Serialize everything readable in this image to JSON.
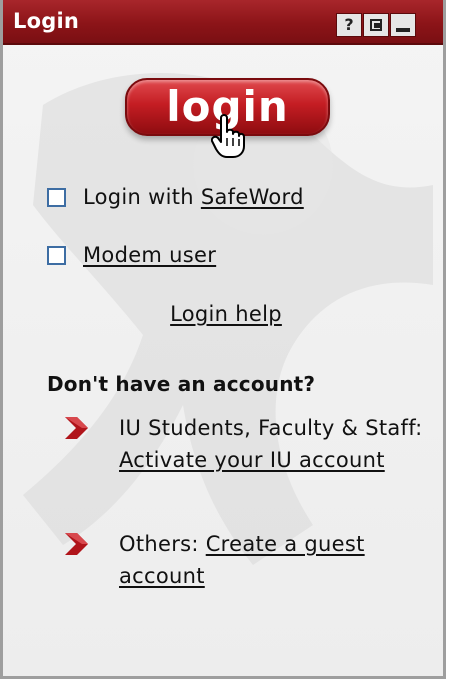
{
  "portlet": {
    "title": "Login",
    "help_button": "?",
    "restore_button_icon": "restore-icon",
    "minimize_button_icon": "minimize-icon"
  },
  "login_button": {
    "label": "login"
  },
  "options": [
    {
      "prefix": "Login with ",
      "link": "SafeWord",
      "checked": false
    },
    {
      "prefix": "",
      "link": "Modem user",
      "checked": false
    }
  ],
  "help_link": "Login help",
  "no_account": {
    "heading": "Don't have an account?",
    "items": [
      {
        "prefix": "IU Students, Faculty & Staff: ",
        "link": "Activate your IU account"
      },
      {
        "prefix": "Others: ",
        "link": "Create a guest account"
      }
    ]
  },
  "colors": {
    "titlebar": "#8c1418",
    "button": "#c41d23",
    "checkbox_border": "#3d6da3",
    "arrow": "#b0141a"
  }
}
